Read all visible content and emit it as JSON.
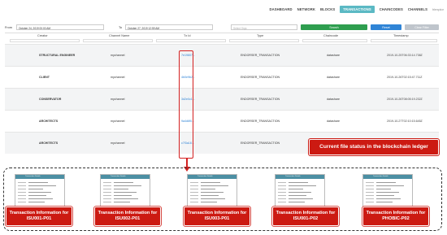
{
  "nav": {
    "items": [
      {
        "label": "DASHBOARD",
        "active": false
      },
      {
        "label": "NETWORK",
        "active": false
      },
      {
        "label": "BLOCKS",
        "active": false
      },
      {
        "label": "TRANSACTIONS",
        "active": true
      },
      {
        "label": "CHAINCODES",
        "active": false
      },
      {
        "label": "CHANNELS",
        "active": false
      }
    ],
    "user": "hlexplor"
  },
  "filter": {
    "from_label": "From",
    "from_value": "October 24, 2019 00:00 AM",
    "to_label": "To",
    "to_value": "October 27, 2019 12:59 AM",
    "select_placeholder": "Select Orgs",
    "search_label": "Search",
    "reset_label": "Reset",
    "clear_label": "Clear Filter"
  },
  "table": {
    "columns": [
      "Creator",
      "Channel Name",
      "Tx Id",
      "Type",
      "Chaincode",
      "Timestamp"
    ],
    "rows": [
      {
        "creator": "STRUCTURAL ENGINEER",
        "channel": "mychannel",
        "txid": "7e19807...",
        "type": "ENDORSER_TRANSACTION",
        "chaincode": "datashare",
        "timestamp": "2019-10-25T06:33:14.738Z"
      },
      {
        "creator": "CLIENT",
        "channel": "mychannel",
        "txid": "4b0e9b2...",
        "type": "ENDORSER_TRANSACTION",
        "chaincode": "datashare",
        "timestamp": "2019-10-26T02:15:47.711Z"
      },
      {
        "creator": "CONSERVATOR",
        "channel": "mychannel",
        "txid": "3d2e0c1...",
        "type": "ENDORSER_TRANSACTION",
        "chaincode": "datashare",
        "timestamp": "2019-10-26T08:05:19.232Z"
      },
      {
        "creator": "ARCHITECTS",
        "channel": "mychannel",
        "txid": "9a4d6f0...",
        "type": "ENDORSER_TRANSACTION",
        "chaincode": "datashare",
        "timestamp": "2019-10-27T02:10:15.645Z"
      },
      {
        "creator": "ARCHITECTS",
        "channel": "mychannel",
        "txid": "c7f3a18...",
        "type": "ENDORSER_TRANSACTION",
        "chaincode": "datashare",
        "timestamp": "2019-10-27T11:05:44.931Z"
      }
    ]
  },
  "callout": "Current file status in the blockchain ledger",
  "cards": [
    {
      "title": "Transaction Details",
      "label": "Transaction Information for ISU001-P01"
    },
    {
      "title": "Transaction Details",
      "label": "Transaction Information for ISU002-P01"
    },
    {
      "title": "Transaction Details",
      "label": "Transaction Information for ISU003-P01"
    },
    {
      "title": "Transaction Details",
      "label": "Transaction Information for ISU001-P02"
    },
    {
      "title": "Transaction Details",
      "label": "Transaction Information for PHOBIC-P02"
    }
  ],
  "colors": {
    "accent_red": "#cc1a12",
    "nav_active": "#5bb9c4",
    "search_green": "#2e9e4f",
    "reset_blue": "#2f84d6",
    "clear_grey": "#bfc5cc"
  }
}
